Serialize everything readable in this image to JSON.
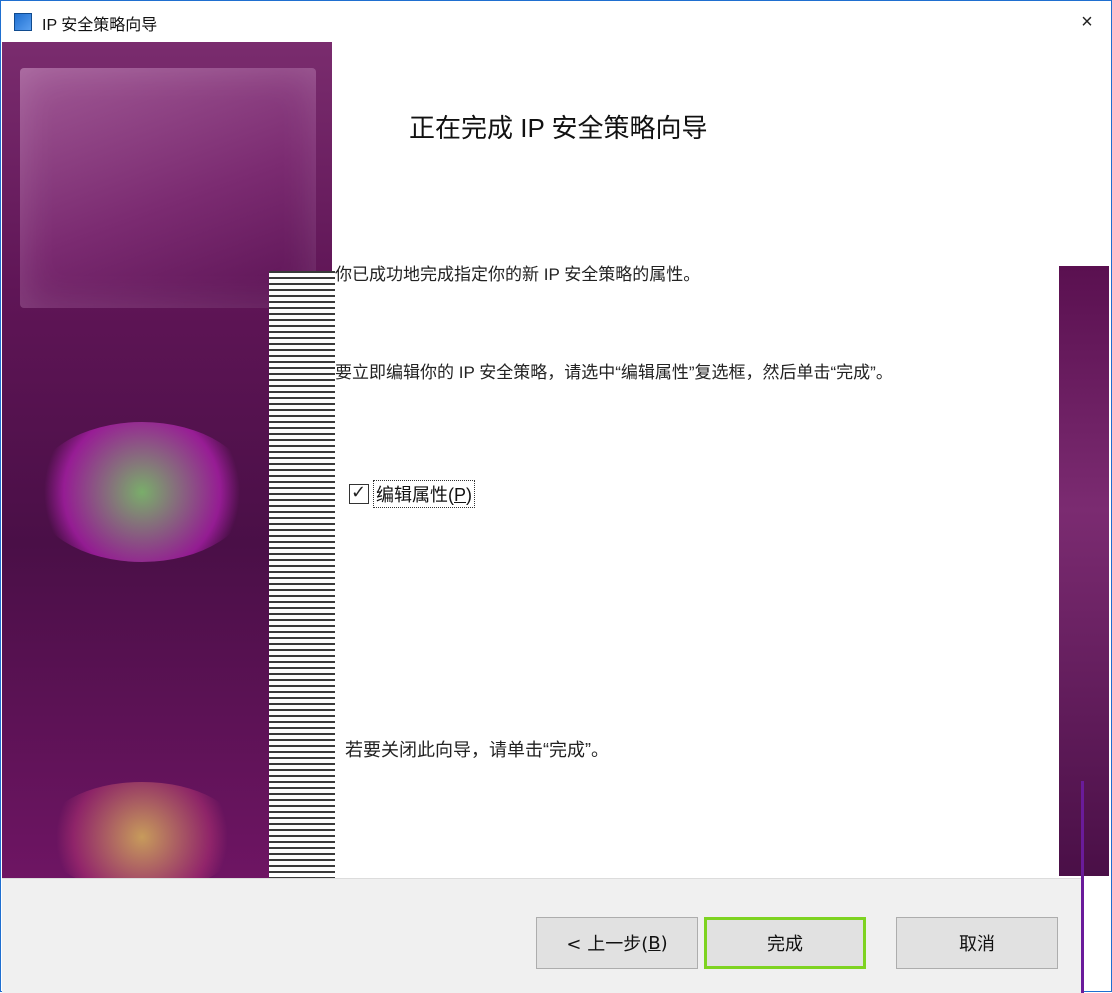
{
  "window": {
    "title": "IP 安全策略向导",
    "close_label": "×"
  },
  "content": {
    "heading": "正在完成 IP 安全策略向导",
    "para1": "你已成功地完成指定你的新 IP 安全策略的属性。",
    "para2": "要立即编辑你的 IP 安全策略，请选中“编辑属性”复选框，然后单击“完成”。",
    "checkbox": {
      "label_prefix": "编辑属性(",
      "hotkey": "P",
      "label_suffix": ")",
      "checked": true,
      "check_glyph": "✓"
    },
    "para3": "若要关闭此向导，请单击“完成”。"
  },
  "footer": {
    "back": {
      "prefix": "< 上一步(",
      "hotkey": "B",
      "suffix": ")"
    },
    "finish": "完成",
    "cancel": "取消"
  },
  "colors": {
    "accent_border": "#1f6fd0",
    "finish_focus": "#7ed321",
    "banner_purple": "#5f1556"
  },
  "icons": {
    "window_icon": "shield-icon",
    "close": "close-icon",
    "check": "check-icon"
  }
}
